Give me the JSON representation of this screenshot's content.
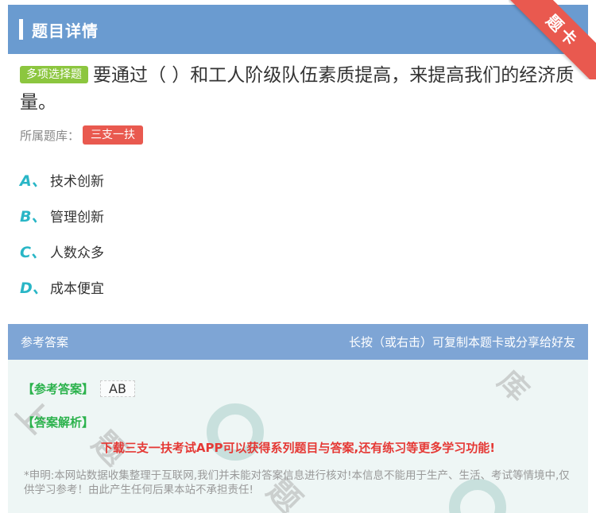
{
  "header": {
    "title": "题目详情"
  },
  "ribbon": {
    "label": "题卡"
  },
  "question": {
    "type_label": "多项选择题",
    "text": "要通过（ ）和工人阶级队伍素质提高，来提高我们的经济质 量。"
  },
  "bank": {
    "label": "所属题库：",
    "name": "三支一扶"
  },
  "options": [
    {
      "letter": "A、",
      "text": "技术创新"
    },
    {
      "letter": "B、",
      "text": "管理创新"
    },
    {
      "letter": "C、",
      "text": "人数众多"
    },
    {
      "letter": "D、",
      "text": "成本便宜"
    }
  ],
  "answer_section": {
    "title": "参考答案",
    "share_hint": "长按（或右击）可复制本题卡或分享给好友",
    "answer_label": "【参考答案】",
    "answer_value": "AB",
    "analysis_label": "【答案解析】",
    "promo": "下载三支一扶考试APP可以获得系列题目与答案,还有练习等更多学习功能!",
    "disclaimer": "*申明:本网站数据收集整理于互联网,我们并未能对答案信息进行核对!本信息不能用于生产、生活、考试等情境中,仅供学习参考！由此产生任何后果本站不承担责任!"
  },
  "colors": {
    "header": "#6a9bd0",
    "ribbon": "#e9594f",
    "type_tag": "#8cc63f",
    "option_letter": "#29b6c6",
    "answer_label": "#2bb24c",
    "promo": "#e53935"
  }
}
